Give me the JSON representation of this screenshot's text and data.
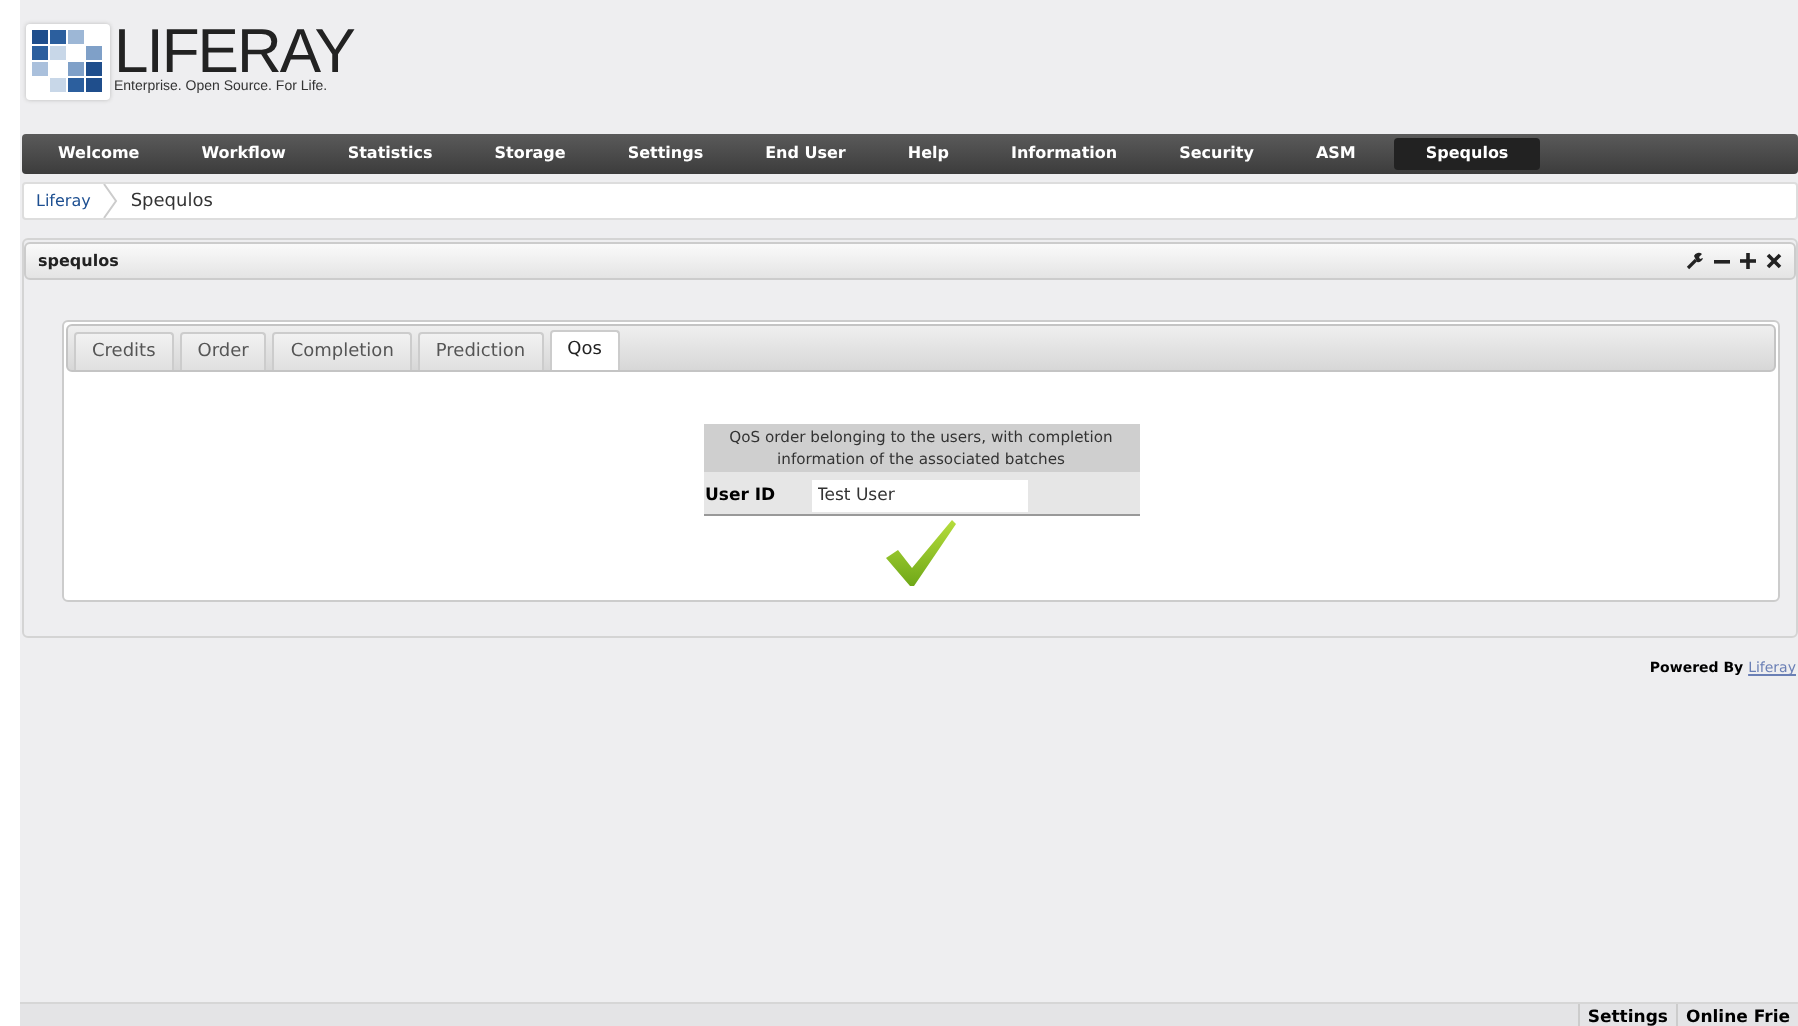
{
  "logo": {
    "name": "LIFERAY",
    "tagline": "Enterprise. Open Source. For Life."
  },
  "nav": [
    {
      "label": "Welcome",
      "selected": false
    },
    {
      "label": "Workflow",
      "selected": false
    },
    {
      "label": "Statistics",
      "selected": false
    },
    {
      "label": "Storage",
      "selected": false
    },
    {
      "label": "Settings",
      "selected": false
    },
    {
      "label": "End User",
      "selected": false
    },
    {
      "label": "Help",
      "selected": false
    },
    {
      "label": "Information",
      "selected": false
    },
    {
      "label": "Security",
      "selected": false
    },
    {
      "label": "ASM",
      "selected": false
    },
    {
      "label": "Spequlos",
      "selected": true
    }
  ],
  "breadcrumb": [
    "Liferay",
    "Spequlos"
  ],
  "portlet": {
    "title": "spequlos",
    "tabs": [
      {
        "label": "Credits",
        "selected": false
      },
      {
        "label": "Order",
        "selected": false
      },
      {
        "label": "Completion",
        "selected": false
      },
      {
        "label": "Prediction",
        "selected": false
      },
      {
        "label": "Qos",
        "selected": true
      }
    ],
    "caption": "QoS order belonging to the users, with completion information of the associated batches",
    "field": {
      "label": "User ID",
      "value": "Test User"
    }
  },
  "footer": {
    "text": "Powered By",
    "link": "Liferay"
  },
  "dock": [
    "Settings",
    "Online Frie"
  ]
}
